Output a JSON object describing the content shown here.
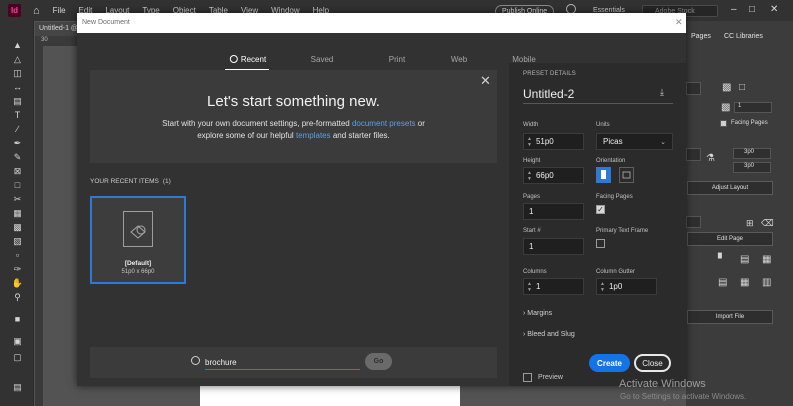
{
  "menubar": {
    "logo": "Id",
    "items": [
      "File",
      "Edit",
      "Layout",
      "Type",
      "Object",
      "Table",
      "View",
      "Window",
      "Help"
    ],
    "publish_online": "Publish Online",
    "workspace": "Essentials",
    "stock_search_placeholder": "Adobe Stock"
  },
  "document": {
    "tab_label": "Untitled-1 @",
    "ruler_mark": "30"
  },
  "dialog": {
    "title": "New Document",
    "tabs": [
      "Recent",
      "Saved",
      "Print",
      "Web",
      "Mobile"
    ],
    "active_tab": "Recent",
    "hero": {
      "heading": "Let's start something new.",
      "text_1": "Start with your own document settings, pre-formatted",
      "link_presets": "document presets",
      "text_2": "or",
      "text_3": "explore some of our helpful",
      "link_templates": "templates",
      "text_4": "and starter files."
    },
    "recent": {
      "label": "YOUR RECENT ITEMS",
      "count": "(1)",
      "items": [
        {
          "name": "[Default]",
          "size": "51p0 x 66p0"
        }
      ]
    },
    "search": {
      "value": "brochure",
      "go_label": "Go"
    }
  },
  "preset": {
    "section_label": "PRESET DETAILS",
    "name": "Untitled-2",
    "width_label": "Width",
    "width": "51p0",
    "units_label": "Units",
    "units": "Picas",
    "height_label": "Height",
    "height": "66p0",
    "orientation_label": "Orientation",
    "pages_label": "Pages",
    "pages": "1",
    "facing_pages_label": "Facing Pages",
    "start_label": "Start #",
    "start": "1",
    "primary_text_frame_label": "Primary Text Frame",
    "columns_label": "Columns",
    "columns": "1",
    "gutter_label": "Column Gutter",
    "gutter": "1p0",
    "margins_label": "Margins",
    "bleed_label": "Bleed and Slug",
    "preview_label": "Preview",
    "create_label": "Create",
    "close_label": "Close"
  },
  "right_panel": {
    "tab_pages": "Pages",
    "tab_libraries": "CC Libraries",
    "facing_pages_label": "Facing Pages",
    "pages_value": "1",
    "cols_value_1": "3p0",
    "cols_value_2": "3p0",
    "adjust_layout_label": "Adjust Layout",
    "edit_page_label": "Edit Page",
    "import_file_label": "Import File"
  },
  "watermark": {
    "title": "Activate Windows",
    "subtitle": "Go to Settings to activate Windows."
  },
  "colors": {
    "accent": "#1473e6",
    "selection": "#2f78d6",
    "link": "#5d9fe6"
  },
  "icons": [
    "home-icon",
    "search-icon",
    "close-icon",
    "save-preset-icon",
    "portrait-icon",
    "landscape-icon",
    "document-icon"
  ]
}
